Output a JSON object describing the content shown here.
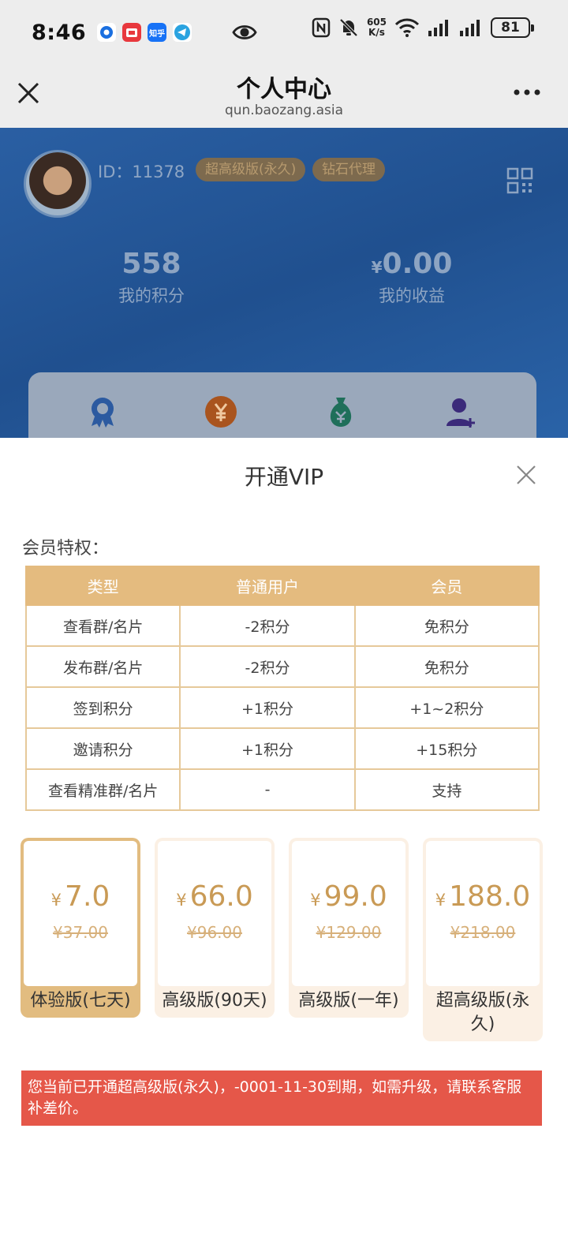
{
  "status_bar": {
    "time": "8:46",
    "apps": [
      "circle-app",
      "baozang-app",
      "知乎",
      "telegram"
    ],
    "net_speed_value": "605",
    "net_speed_unit": "K/s",
    "battery": "81"
  },
  "nav": {
    "title": "个人中心",
    "url": "qun.baozang.asia"
  },
  "profile": {
    "id_text": "ID：11378",
    "badges": [
      "超高级版(永久)",
      "钻石代理"
    ],
    "points_value": "558",
    "points_label": "我的积分",
    "earnings_currency": "¥",
    "earnings_value": "0.00",
    "earnings_label": "我的收益"
  },
  "modal": {
    "title": "开通VIP",
    "perks_label": "会员特权：",
    "table": {
      "headers": [
        "类型",
        "普通用户",
        "会员"
      ],
      "rows": [
        [
          "查看群/名片",
          "-2积分",
          "免积分"
        ],
        [
          "发布群/名片",
          "-2积分",
          "免积分"
        ],
        [
          "签到积分",
          "+1积分",
          "+1~2积分"
        ],
        [
          "邀请积分",
          "+1积分",
          "+15积分"
        ],
        [
          "查看精准群/名片",
          "-",
          "支持"
        ]
      ]
    },
    "plans": [
      {
        "currency": "¥",
        "price": "7.0",
        "old_price": "¥37.00",
        "name": "体验版(七天)",
        "selected": true
      },
      {
        "currency": "¥",
        "price": "66.0",
        "old_price": "¥96.00",
        "name": "高级版(90天)",
        "selected": false
      },
      {
        "currency": "¥",
        "price": "99.0",
        "old_price": "¥129.00",
        "name": "高级版(一年)",
        "selected": false
      },
      {
        "currency": "¥",
        "price": "188.0",
        "old_price": "¥218.00",
        "name": "超高级版(永久)",
        "selected": false
      }
    ],
    "notice": "您当前已开通超高级版(永久)，-0001-11-30到期，如需升级，请联系客服补差价。"
  },
  "colors": {
    "gold": "#e2bc80",
    "price": "#c99a55",
    "notice_bg": "#e55749",
    "profile_bg": "#2a5fa3"
  }
}
